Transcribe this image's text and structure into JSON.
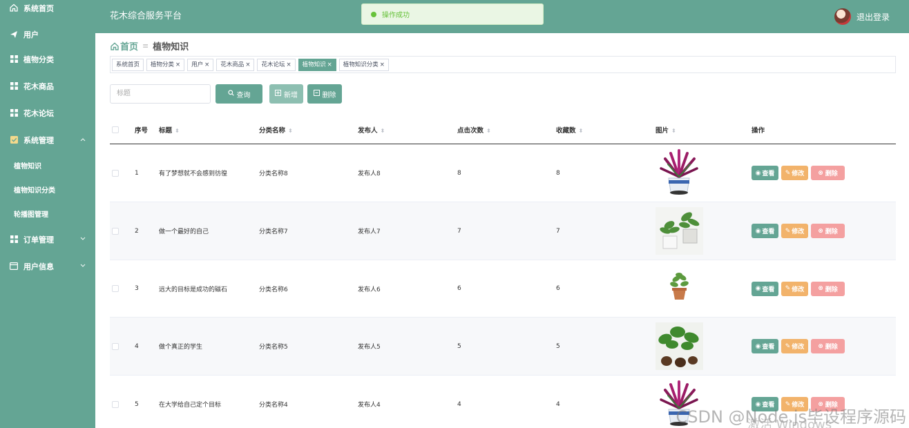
{
  "sidebar": {
    "items": [
      {
        "label": "系统首页",
        "icon": "home-icon"
      },
      {
        "label": "用户",
        "icon": "send-icon"
      },
      {
        "label": "植物分类",
        "icon": "grid-icon"
      },
      {
        "label": "花木商品",
        "icon": "grid-icon"
      },
      {
        "label": "花木论坛",
        "icon": "grid-icon"
      },
      {
        "label": "系统管理",
        "icon": "check-icon"
      },
      {
        "label": "订单管理",
        "icon": "grid-icon"
      },
      {
        "label": "用户信息",
        "icon": "card-icon"
      }
    ],
    "sub": [
      "植物知识",
      "植物知识分类",
      "轮播图管理"
    ]
  },
  "header": {
    "title": "花木综合服务平台",
    "logout": "退出登录"
  },
  "toast": {
    "message": "操作成功"
  },
  "breadcrumb": {
    "home": "首页",
    "current": "植物知识"
  },
  "tags": [
    {
      "label": "系统首页",
      "closable": false
    },
    {
      "label": "植物分类",
      "closable": true
    },
    {
      "label": "用户",
      "closable": true
    },
    {
      "label": "花木商品",
      "closable": true
    },
    {
      "label": "花木论坛",
      "closable": true
    },
    {
      "label": "植物知识",
      "closable": true,
      "active": true
    },
    {
      "label": "植物知识分类",
      "closable": true
    }
  ],
  "toolbar": {
    "search_placeholder": "标题",
    "query_label": "查询",
    "add_label": "新增",
    "delete_label": "删除"
  },
  "table": {
    "headers": [
      "序号",
      "标题",
      "分类名称",
      "发布人",
      "点击次数",
      "收藏数",
      "图片",
      "操作"
    ],
    "op_labels": {
      "view": "查看",
      "edit": "修改",
      "delete": "删除"
    },
    "rows": [
      {
        "idx": "1",
        "title": "有了梦想就不会感到彷徨",
        "cat": "分类名称8",
        "pub": "发布人8",
        "clicks": "8",
        "fav": "8",
        "img": "purple"
      },
      {
        "idx": "2",
        "title": "做一个最好的自己",
        "cat": "分类名称7",
        "pub": "发布人7",
        "clicks": "7",
        "fav": "7",
        "img": "green2"
      },
      {
        "idx": "3",
        "title": "远大的目标是成功的磁石",
        "cat": "分类名称6",
        "pub": "发布人6",
        "clicks": "6",
        "fav": "6",
        "img": "small"
      },
      {
        "idx": "4",
        "title": "做个真正的学生",
        "cat": "分类名称5",
        "pub": "发布人5",
        "clicks": "5",
        "fav": "5",
        "img": "green3"
      },
      {
        "idx": "5",
        "title": "在大学给自己定个目标",
        "cat": "分类名称4",
        "pub": "发布人4",
        "clicks": "4",
        "fav": "4",
        "img": "purple"
      }
    ]
  },
  "overlay": {
    "watermark": "CSDN @Node.js毕设程序源码",
    "activate": "激活 Windows"
  },
  "colors": {
    "primary": "#64a594",
    "edit": "#f2b36b",
    "danger": "#f4a0a0",
    "success": "#67c23a"
  }
}
